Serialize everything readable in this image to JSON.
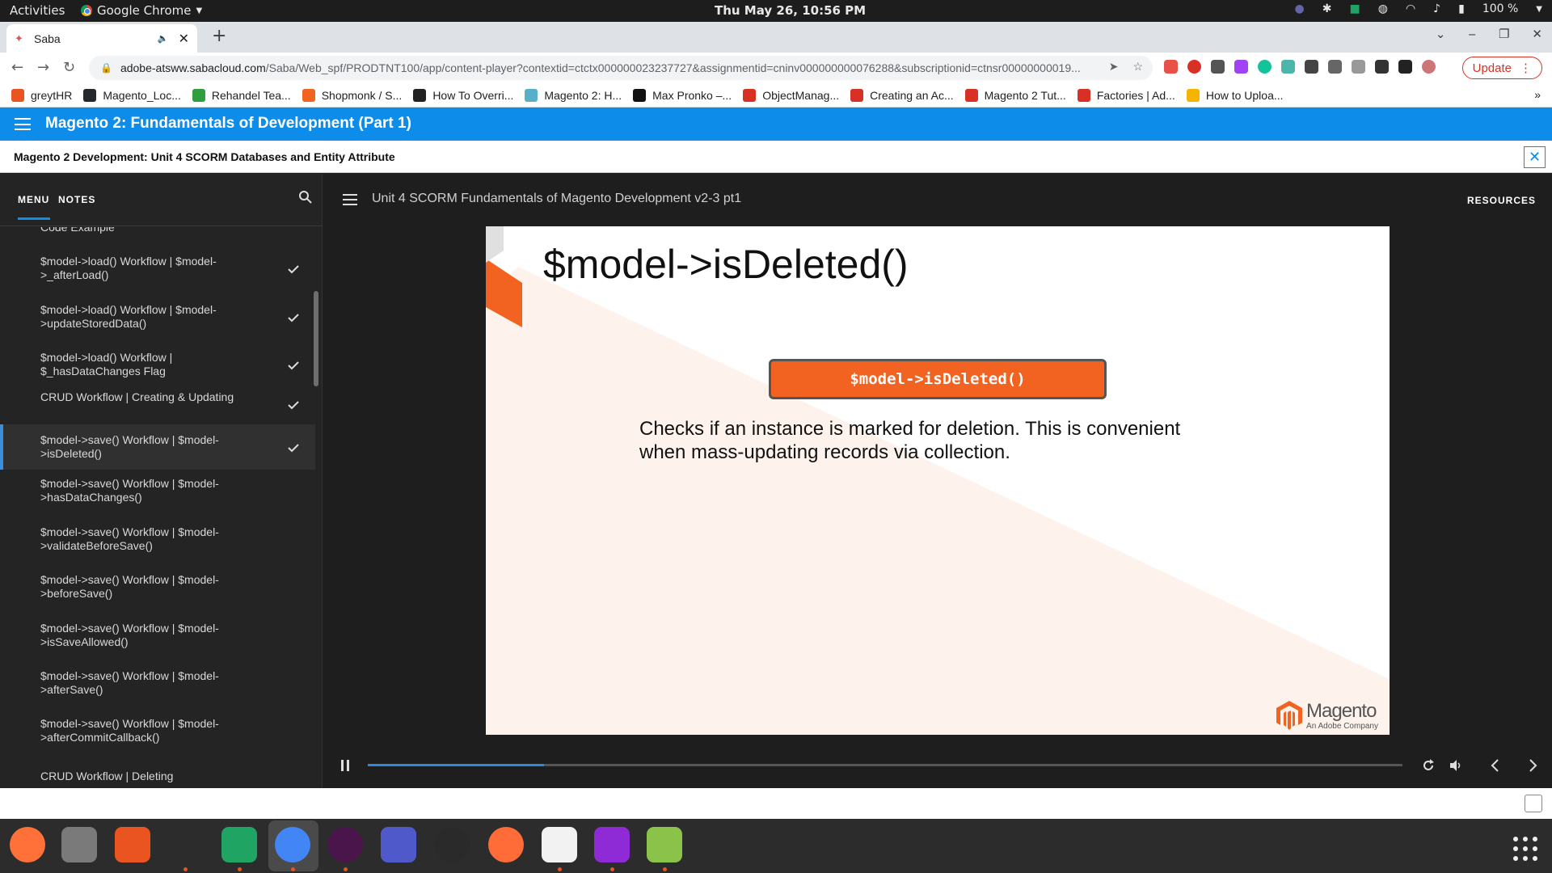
{
  "os_bar": {
    "activities": "Activities",
    "app_name": "Google Chrome",
    "clock": "Thu May 26, 10:56 PM",
    "battery": "100 %"
  },
  "browser": {
    "tab_title": "Saba",
    "url_host": "adobe-atsww.sabacloud.com",
    "url_path": "/Saba/Web_spf/PRODTNT100/app/content-player?contextid=ctctx000000023237727&assignmentid=cninv000000000076288&subscriptionid=ctnsr00000000019...",
    "update_label": "Update",
    "bookmarks": [
      {
        "label": "greytHR",
        "color": "#e95420"
      },
      {
        "label": "Magento_Loc...",
        "color": "#24292e"
      },
      {
        "label": "Rehandel Tea...",
        "color": "#2e9e3e"
      },
      {
        "label": "Shopmonk / S...",
        "color": "#f26322"
      },
      {
        "label": "How To Overri...",
        "color": "#222222"
      },
      {
        "label": "Magento 2: H...",
        "color": "#55b0c8"
      },
      {
        "label": "Max Pronko –...",
        "color": "#111111"
      },
      {
        "label": "ObjectManag...",
        "color": "#d93025"
      },
      {
        "label": "Creating an Ac...",
        "color": "#d93025"
      },
      {
        "label": "Magento 2 Tut...",
        "color": "#d93025"
      },
      {
        "label": "Factories | Ad...",
        "color": "#d93025"
      },
      {
        "label": "How to Uploa...",
        "color": "#f4b400"
      }
    ]
  },
  "app": {
    "course_title": "Magento 2: Fundamentals of Development (Part 1)",
    "unit_title": "Magento 2 Development: Unit 4 SCORM Databases and Entity Attribute",
    "side_tabs": {
      "menu": "MENU",
      "notes": "NOTES"
    },
    "content_title": "Unit 4 SCORM Fundamentals of Magento Development v2-3 pt1",
    "resources": "RESOURCES",
    "menu_items": [
      {
        "label": "Code Example",
        "checked": false
      },
      {
        "label": "$model->load() Workflow | $model->_afterLoad()",
        "checked": true
      },
      {
        "label": "$model->load() Workflow | $model->updateStoredData()",
        "checked": true
      },
      {
        "label": "$model->load() Workflow | $_hasDataChanges Flag",
        "checked": true
      },
      {
        "label": "CRUD Workflow | Creating & Updating",
        "checked": true
      },
      {
        "label": "$model->save() Workflow | $model->isDeleted()",
        "checked": true
      },
      {
        "label": "$model->save() Workflow | $model->hasDataChanges()",
        "checked": false
      },
      {
        "label": "$model->save() Workflow | $model->validateBeforeSave()",
        "checked": false
      },
      {
        "label": "$model->save() Workflow | $model->beforeSave()",
        "checked": false
      },
      {
        "label": "$model->save() Workflow | $model->isSaveAllowed()",
        "checked": false
      },
      {
        "label": "$model->save() Workflow | $model->afterSave()",
        "checked": false
      },
      {
        "label": "$model->save() Workflow | $model->afterCommitCallback()",
        "checked": false
      },
      {
        "label": "CRUD Workflow | Deleting",
        "checked": false
      }
    ],
    "slide": {
      "title": "$model->isDeleted()",
      "code_button": "$model->isDeleted()",
      "description": "Checks if an instance is marked for deletion. This is convenient when mass-updating records via collection.",
      "logo_word": "Magento",
      "logo_sub": "An Adobe Company"
    },
    "playback_progress": 0.17,
    "accent_color": "#0d8ce9",
    "slide_orange": "#f26322"
  },
  "dock": {
    "apps": [
      "firefox-icon",
      "files-icon",
      "software-center-icon",
      "terminal-icon",
      "google-chat-icon",
      "chrome-icon",
      "slack-icon",
      "teams-icon",
      "camera-icon",
      "postman-icon",
      "text-editor-icon",
      "phpstorm-icon",
      "image-viewer-icon"
    ]
  }
}
